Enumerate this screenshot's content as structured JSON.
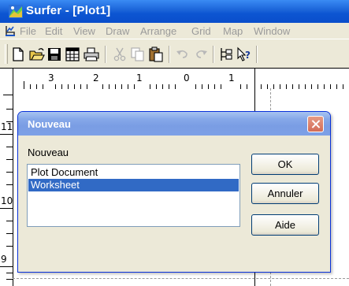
{
  "window": {
    "title": "Surfer - [Plot1]",
    "icon": "surfer-app-icon"
  },
  "menubar": {
    "items": [
      "File",
      "Edit",
      "View",
      "Draw",
      "Arrange",
      "Grid",
      "Map",
      "Window"
    ]
  },
  "toolbar": {
    "buttons": [
      "new-file-icon",
      "open-folder-icon",
      "save-icon",
      "worksheet-icon",
      "print-icon",
      "cut-icon",
      "copy-icon",
      "paste-icon",
      "undo-icon",
      "redo-icon",
      "object-manager-icon",
      "context-help-icon"
    ]
  },
  "ruler": {
    "top_labels": [
      "3",
      "2",
      "1",
      "0",
      "1"
    ],
    "left_labels": [
      "11",
      "10",
      "9"
    ]
  },
  "dialog": {
    "title": "Nouveau",
    "label": "Nouveau",
    "list_items": [
      "Plot Document",
      "Worksheet"
    ],
    "selected_item": "Worksheet",
    "ok_label": "OK",
    "cancel_label": "Annuler",
    "help_label": "Aide"
  },
  "colors": {
    "titlebar": "#0c55d2",
    "selection": "#316ac5",
    "dialog_bg": "#ece9d8"
  }
}
